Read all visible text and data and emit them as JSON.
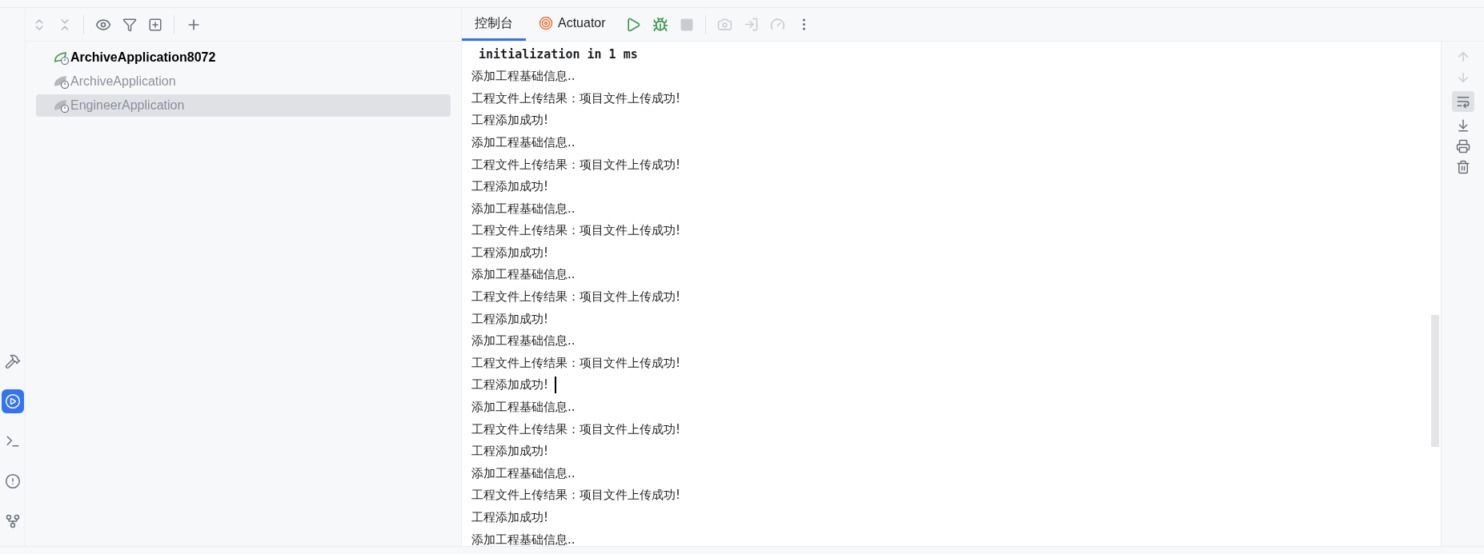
{
  "tool_strip": [
    {
      "kind": "hammer",
      "selected": false
    },
    {
      "kind": "run",
      "selected": true
    },
    {
      "kind": "terminal",
      "selected": false
    },
    {
      "kind": "problems",
      "selected": false
    },
    {
      "kind": "git",
      "selected": false
    }
  ],
  "services": {
    "items": [
      {
        "label": "ArchiveApplication8072",
        "running": true,
        "selected": false
      },
      {
        "label": "ArchiveApplication",
        "running": false,
        "selected": false
      },
      {
        "label": "EngineerApplication",
        "running": false,
        "selected": true
      }
    ]
  },
  "console": {
    "tabs": [
      {
        "label": "控制台",
        "kind": "console",
        "selected": true
      },
      {
        "label": "Actuator",
        "kind": "actuator",
        "selected": false
      }
    ],
    "lines": [
      {
        "text": " initialization in 1 ms",
        "kind": "mono",
        "cursor": false
      },
      {
        "text": "添加工程基础信息..",
        "kind": "plain",
        "cursor": false
      },
      {
        "text": "工程文件上传结果：项目文件上传成功!",
        "kind": "plain",
        "cursor": false
      },
      {
        "text": "工程添加成功!",
        "kind": "plain",
        "cursor": false
      },
      {
        "text": "添加工程基础信息..",
        "kind": "plain",
        "cursor": false
      },
      {
        "text": "工程文件上传结果：项目文件上传成功!",
        "kind": "plain",
        "cursor": false
      },
      {
        "text": "工程添加成功!",
        "kind": "plain",
        "cursor": false
      },
      {
        "text": "添加工程基础信息..",
        "kind": "plain",
        "cursor": false
      },
      {
        "text": "工程文件上传结果：项目文件上传成功!",
        "kind": "plain",
        "cursor": false
      },
      {
        "text": "工程添加成功!",
        "kind": "plain",
        "cursor": false
      },
      {
        "text": "添加工程基础信息..",
        "kind": "plain",
        "cursor": false
      },
      {
        "text": "工程文件上传结果：项目文件上传成功!",
        "kind": "plain",
        "cursor": false
      },
      {
        "text": "工程添加成功!",
        "kind": "plain",
        "cursor": false
      },
      {
        "text": "添加工程基础信息..",
        "kind": "plain",
        "cursor": false
      },
      {
        "text": "工程文件上传结果：项目文件上传成功!",
        "kind": "plain",
        "cursor": false
      },
      {
        "text": "工程添加成功!",
        "kind": "plain",
        "cursor": true
      },
      {
        "text": "添加工程基础信息..",
        "kind": "plain",
        "cursor": false
      },
      {
        "text": "工程文件上传结果：项目文件上传成功!",
        "kind": "plain",
        "cursor": false
      },
      {
        "text": "工程添加成功!",
        "kind": "plain",
        "cursor": false
      },
      {
        "text": "添加工程基础信息..",
        "kind": "plain",
        "cursor": false
      },
      {
        "text": "工程文件上传结果：项目文件上传成功!",
        "kind": "plain",
        "cursor": false
      },
      {
        "text": "工程添加成功!",
        "kind": "plain",
        "cursor": false
      },
      {
        "text": "添加工程基础信息..",
        "kind": "plain",
        "cursor": false
      }
    ],
    "soft_wrap": {
      "on": true
    }
  }
}
